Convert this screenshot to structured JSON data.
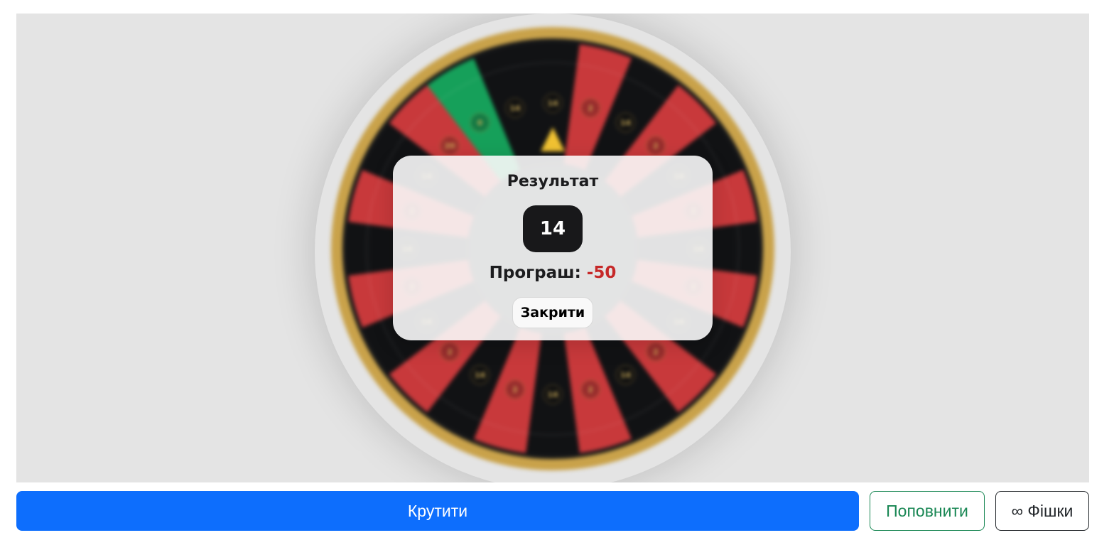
{
  "modal": {
    "title": "Результат",
    "result_number": "14",
    "outcome_label": "Програш:",
    "outcome_amount": "-50",
    "close_label": "Закрити"
  },
  "controls": {
    "spin_label": "Крутити",
    "topup_label": "Поповнити",
    "chips_icon": "infinity-icon",
    "chips_icon_glyph": "∞",
    "chips_label": "Фішки"
  },
  "wheel": {
    "segments": [
      {
        "color": "#111214",
        "label": "14"
      },
      {
        "color": "#c8393b",
        "label": "2"
      },
      {
        "color": "#111214",
        "label": "14"
      },
      {
        "color": "#c8393b",
        "label": "2"
      },
      {
        "color": "#111214",
        "label": "14"
      },
      {
        "color": "#c8393b",
        "label": "2"
      },
      {
        "color": "#111214",
        "label": "14"
      },
      {
        "color": "#c8393b",
        "label": "2"
      },
      {
        "color": "#111214",
        "label": "14"
      },
      {
        "color": "#c8393b",
        "label": "2"
      },
      {
        "color": "#111214",
        "label": "14"
      },
      {
        "color": "#c8393b",
        "label": "2"
      },
      {
        "color": "#111214",
        "label": "14"
      },
      {
        "color": "#c8393b",
        "label": "2"
      },
      {
        "color": "#111214",
        "label": "14"
      },
      {
        "color": "#c8393b",
        "label": "2"
      },
      {
        "color": "#111214",
        "label": "14"
      },
      {
        "color": "#c8393b",
        "label": "2"
      },
      {
        "color": "#111214",
        "label": "14"
      },
      {
        "color": "#c8393b",
        "label": "2"
      },
      {
        "color": "#111214",
        "label": "14"
      },
      {
        "color": "#c8393b",
        "label": "20"
      },
      {
        "color": "#16a05a",
        "label": "0"
      },
      {
        "color": "#111214",
        "label": "14"
      }
    ],
    "rim_color": "#c9a24a",
    "pointer_color": "#f1c232"
  },
  "colors": {
    "accent": "#0d6efd",
    "success": "#198754",
    "loss": "#c62828"
  }
}
